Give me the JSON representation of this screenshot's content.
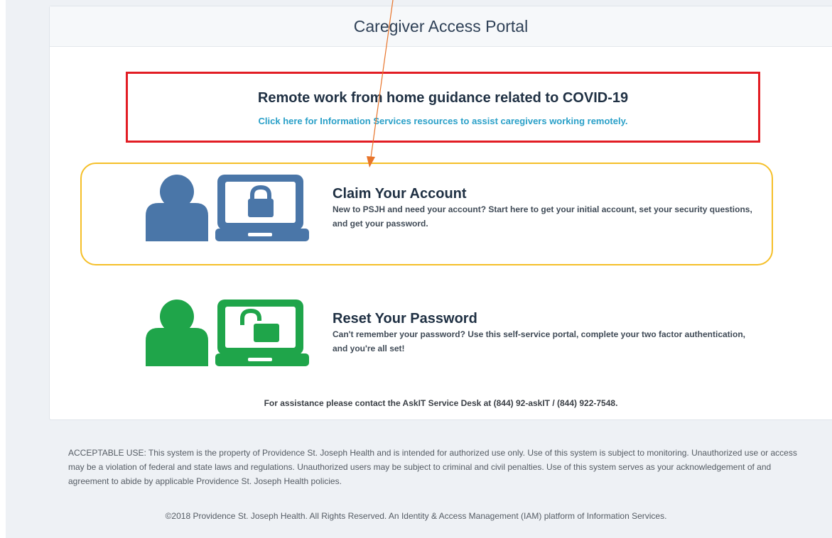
{
  "portal": {
    "title": "Caregiver Access Portal"
  },
  "notice": {
    "heading": "Remote work from home guidance related to COVID-19",
    "link": "Click here for Information Services resources to assist caregivers working remotely.",
    "border_color": "#e21d24",
    "link_color": "#2aa0c8"
  },
  "options": [
    {
      "title": "Claim Your Account",
      "description": "New to PSJH and need your account? Start here to get your initial account, set your security questions, and get your password.",
      "icon": "user-locked-laptop-icon",
      "color": "#4a76a8",
      "highlight_color": "#f5bf28"
    },
    {
      "title": "Reset Your Password",
      "description": "Can't remember your password? Use this self-service portal, complete your two factor authentication, and you're all set!",
      "icon": "user-unlocked-laptop-icon",
      "color": "#1fa54a"
    }
  ],
  "assistance": "For assistance please contact the AskIT Service Desk at (844) 92-askIT / (844) 922-7548.",
  "footer": {
    "acceptable_use": "ACCEPTABLE USE: This system is the property of Providence St. Joseph Health and is intended for authorized use only. Use of this system is subject to monitoring. Unauthorized use or access may be a violation of federal and state laws and regulations. Unauthorized users may be subject to criminal and civil penalties. Use of this system serves as your acknowledgement of and agreement to abide by applicable Providence St. Joseph Health policies.",
    "copyright": "©2018 Providence St. Joseph Health. All Rights Reserved. An Identity & Access Management (IAM) platform of Information Services."
  },
  "annotation": {
    "arrow_color": "#e8742a"
  }
}
